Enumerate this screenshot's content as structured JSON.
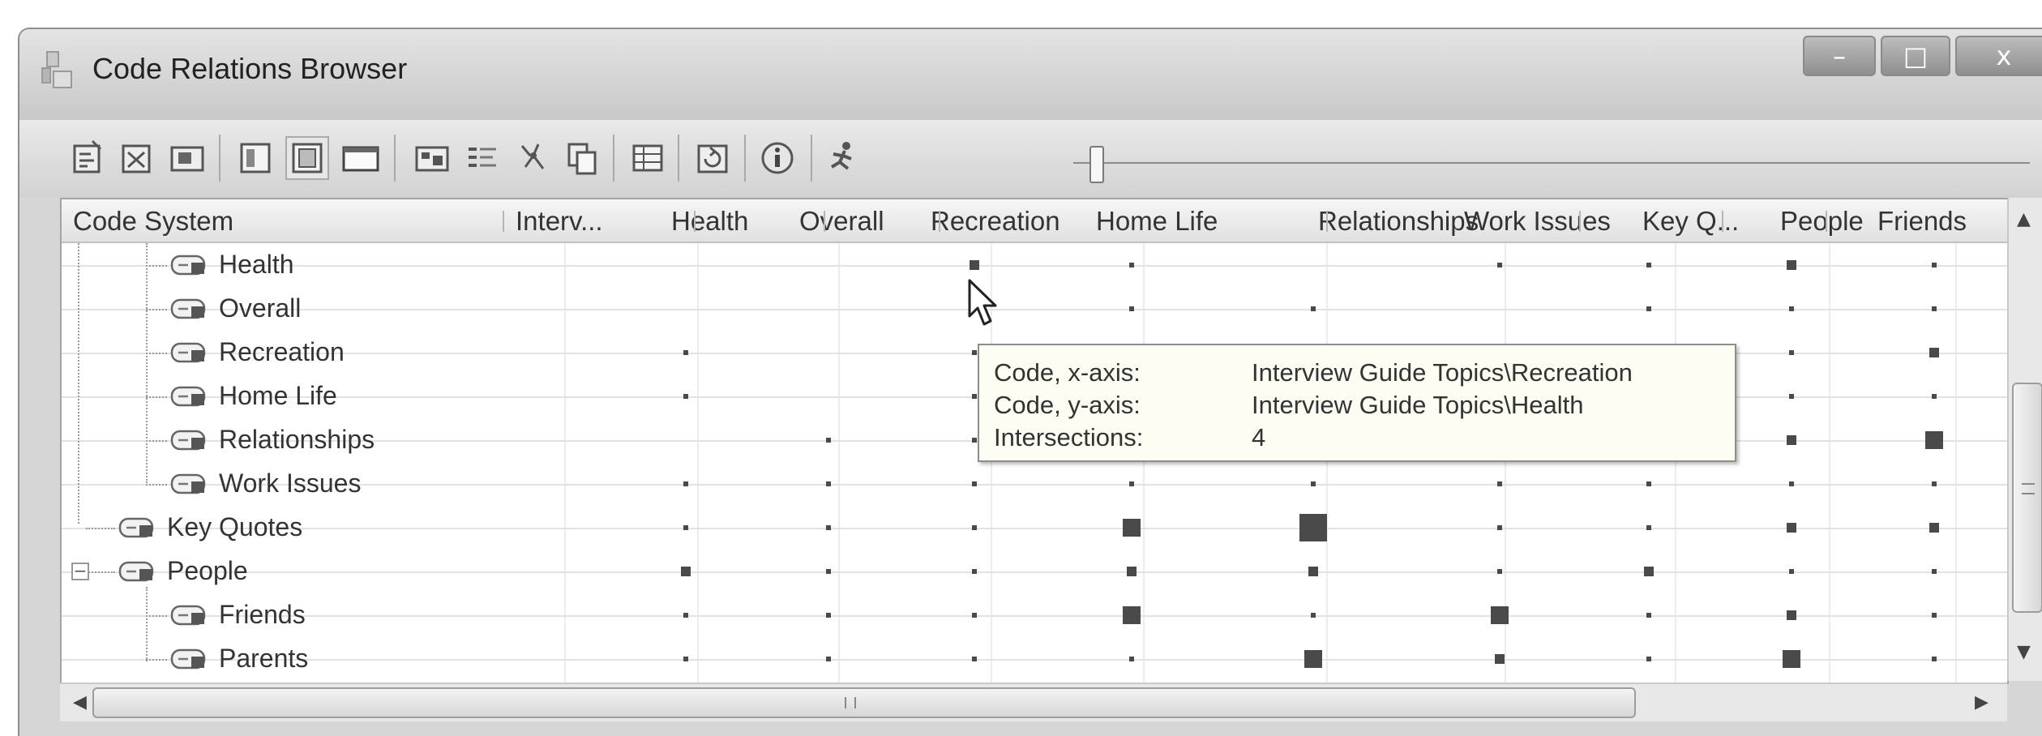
{
  "window": {
    "title": "Code Relations Browser",
    "buttons": {
      "minimize": "–",
      "maximize": "□",
      "close": "x"
    }
  },
  "toolbar": {
    "icons": [
      "export-icon",
      "export-excel-icon",
      "export-image-icon",
      "layout-left-icon",
      "layout-center-icon",
      "layout-full-icon",
      "display-squares-icon",
      "display-list-icon",
      "filter-icon",
      "copy-icon",
      "table-icon",
      "refresh-icon",
      "info-icon",
      "runner-icon"
    ]
  },
  "grid": {
    "header": {
      "code_system": "Code System",
      "columns": [
        "Interv...",
        "Health",
        "Overall",
        "Recreation",
        "Home Life",
        "Relationships",
        "Work Issues",
        "Key Q...",
        "People",
        "Friends"
      ]
    },
    "rows": [
      {
        "label": "Health",
        "level": 2
      },
      {
        "label": "Overall",
        "level": 2
      },
      {
        "label": "Recreation",
        "level": 2
      },
      {
        "label": "Home Life",
        "level": 2
      },
      {
        "label": "Relationships",
        "level": 2
      },
      {
        "label": "Work Issues",
        "level": 2
      },
      {
        "label": "Key Quotes",
        "level": 1
      },
      {
        "label": "People",
        "level": 1,
        "expander": "−"
      },
      {
        "label": "Friends",
        "level": 2
      },
      {
        "label": "Parents",
        "level": 2
      }
    ],
    "cells": [
      [
        0,
        0,
        0,
        2,
        1,
        0,
        1,
        1,
        2,
        1
      ],
      [
        0,
        0,
        0,
        0,
        1,
        1,
        0,
        1,
        1,
        1
      ],
      [
        0,
        1,
        0,
        1,
        1,
        1,
        1,
        0,
        1,
        2
      ],
      [
        0,
        1,
        0,
        1,
        1,
        1,
        0,
        1,
        1,
        1
      ],
      [
        0,
        0,
        1,
        1,
        2,
        1,
        1,
        3,
        2,
        3
      ],
      [
        0,
        1,
        1,
        1,
        1,
        1,
        1,
        1,
        1,
        1
      ],
      [
        0,
        1,
        1,
        1,
        3,
        4,
        1,
        1,
        2,
        2
      ],
      [
        0,
        2,
        1,
        1,
        2,
        2,
        1,
        2,
        1,
        1
      ],
      [
        0,
        1,
        1,
        1,
        3,
        1,
        3,
        1,
        2,
        1
      ],
      [
        0,
        1,
        1,
        1,
        1,
        3,
        2,
        1,
        3,
        1
      ]
    ]
  },
  "tooltip": {
    "rows": [
      {
        "label": "Code, x-axis:",
        "value": "Interview Guide Topics\\Recreation"
      },
      {
        "label": "Code, y-axis:",
        "value": "Interview Guide Topics\\Health"
      },
      {
        "label": "Intersections:",
        "value": "4"
      }
    ]
  },
  "scrollbars": {
    "up": "▲",
    "down": "▼",
    "left": "◀",
    "right": "▶"
  }
}
